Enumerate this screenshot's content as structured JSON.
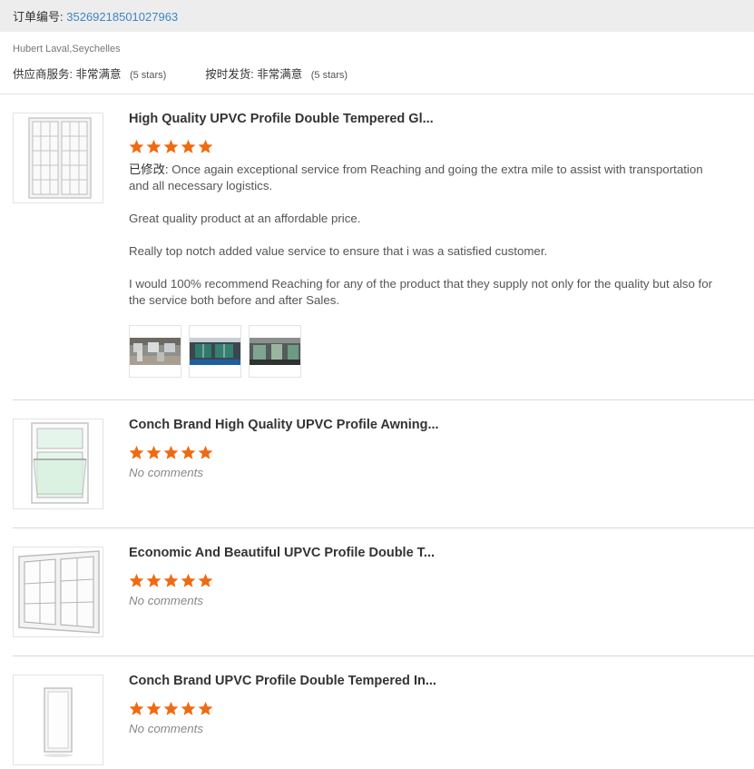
{
  "order": {
    "label": "订单编号:",
    "number": "35269218501027963"
  },
  "buyer": {
    "name": "Hubert Laval,Seychelles"
  },
  "ratings": {
    "supplier_label": "供应商服务:",
    "supplier_value": "非常满意",
    "supplier_stars": "(5 stars)",
    "delivery_label": "按时发货:",
    "delivery_value": "非常满意",
    "delivery_stars": "(5 stars)"
  },
  "colors": {
    "star": "#f06a11",
    "link": "#3d85c6"
  },
  "items": [
    {
      "title": "High Quality UPVC Profile Double Tempered Gl...",
      "rating": 5,
      "comment_label": "已修改:",
      "comment_p1": " Once again exceptional service from Reaching and going the extra mile to assist with transportation and all necessary logistics.",
      "comment_p2": "Great quality product at an affordable price.",
      "comment_p3": "Really top notch added value service to ensure that i was a satisfied customer.",
      "comment_p4": "I would 100% recommend Reaching for any of the product that they supply not only for the quality but also for the service both before and after Sales.",
      "photos": [
        "review-photo-1",
        "review-photo-2",
        "review-photo-3"
      ]
    },
    {
      "title": "Conch Brand High Quality UPVC Profile Awning...",
      "rating": 5,
      "comment": "No comments"
    },
    {
      "title": "Economic And Beautiful UPVC Profile Double T...",
      "rating": 5,
      "comment": "No comments"
    },
    {
      "title": "Conch Brand UPVC Profile Double Tempered In...",
      "rating": 5,
      "comment": "No comments"
    }
  ]
}
